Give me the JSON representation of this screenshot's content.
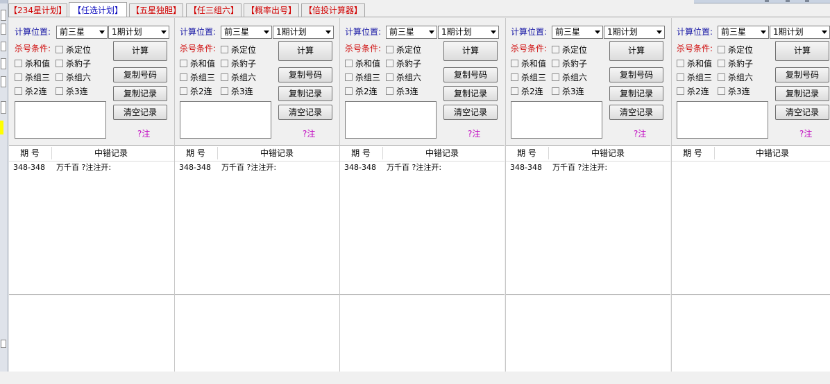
{
  "tabs": [
    {
      "label": "【234星计划】",
      "active": false
    },
    {
      "label": "【任选计划】",
      "active": true
    },
    {
      "label": "【五星独胆】",
      "active": false
    },
    {
      "label": "【任三组六】",
      "active": false
    },
    {
      "label": "【概率出号】",
      "active": false
    },
    {
      "label": "【倍投计算器】",
      "active": false
    }
  ],
  "panels": [
    {
      "calc_label": "计算位置:",
      "position_value": "前三星",
      "plan_value": "1期计划",
      "kill_label": "杀号条件:",
      "checkboxes": [
        "杀定位",
        "杀和值",
        "杀豹子",
        "杀组三",
        "杀组六",
        "杀2连",
        "杀3连"
      ],
      "btn_calc": "计算",
      "btn_copy_num": "复制号码",
      "btn_copy_rec": "复制记录",
      "btn_clear": "清空记录",
      "note": "?注",
      "grid_header": [
        "期 号",
        "中错记录"
      ],
      "row": {
        "period": "348-348",
        "record": "万千百  ?注注开:"
      }
    },
    {
      "calc_label": "计算位置:",
      "position_value": "前三星",
      "plan_value": "1期计划",
      "kill_label": "杀号条件:",
      "checkboxes": [
        "杀定位",
        "杀和值",
        "杀豹子",
        "杀组三",
        "杀组六",
        "杀2连",
        "杀3连"
      ],
      "btn_calc": "计算",
      "btn_copy_num": "复制号码",
      "btn_copy_rec": "复制记录",
      "btn_clear": "清空记录",
      "note": "?注",
      "grid_header": [
        "期 号",
        "中错记录"
      ],
      "row": {
        "period": "348-348",
        "record": "万千百  ?注注开:"
      }
    },
    {
      "calc_label": "计算位置:",
      "position_value": "前三星",
      "plan_value": "1期计划",
      "kill_label": "杀号条件:",
      "checkboxes": [
        "杀定位",
        "杀和值",
        "杀豹子",
        "杀组三",
        "杀组六",
        "杀2连",
        "杀3连"
      ],
      "btn_calc": "计算",
      "btn_copy_num": "复制号码",
      "btn_copy_rec": "复制记录",
      "btn_clear": "清空记录",
      "note": "?注",
      "grid_header": [
        "期 号",
        "中错记录"
      ],
      "row": {
        "period": "348-348",
        "record": "万千百  ?注注开:"
      }
    },
    {
      "calc_label": "计算位置:",
      "position_value": "前三星",
      "plan_value": "1期计划",
      "kill_label": "杀号条件:",
      "checkboxes": [
        "杀定位",
        "杀和值",
        "杀豹子",
        "杀组三",
        "杀组六",
        "杀2连",
        "杀3连"
      ],
      "btn_calc": "计算",
      "btn_copy_num": "复制号码",
      "btn_copy_rec": "复制记录",
      "btn_clear": "清空记录",
      "note": "?注",
      "grid_header": [
        "期 号",
        "中错记录"
      ],
      "row": {
        "period": "348-348",
        "record": "万千百  ?注注开:"
      }
    },
    {
      "calc_label": "计算位置:",
      "position_value": "前三星",
      "plan_value": "1期计划",
      "kill_label": "杀号条件:",
      "checkboxes": [
        "杀定位",
        "杀和值",
        "杀豹子",
        "杀组三",
        "杀组六",
        "杀2连",
        "杀3连"
      ],
      "btn_calc": "计算",
      "btn_copy_num": "复制号码",
      "btn_copy_rec": "复制记录",
      "btn_clear": "清空记录",
      "note": "?注",
      "grid_header": [
        "期 号",
        "中错记录"
      ],
      "row": {
        "period": "",
        "record": ""
      }
    }
  ],
  "colors": {
    "tab_text": "#d00000",
    "active_tab_text": "#1010c0",
    "calc_label": "#1a1aa6",
    "kill_label": "#d01010",
    "note": "#c000c0"
  }
}
